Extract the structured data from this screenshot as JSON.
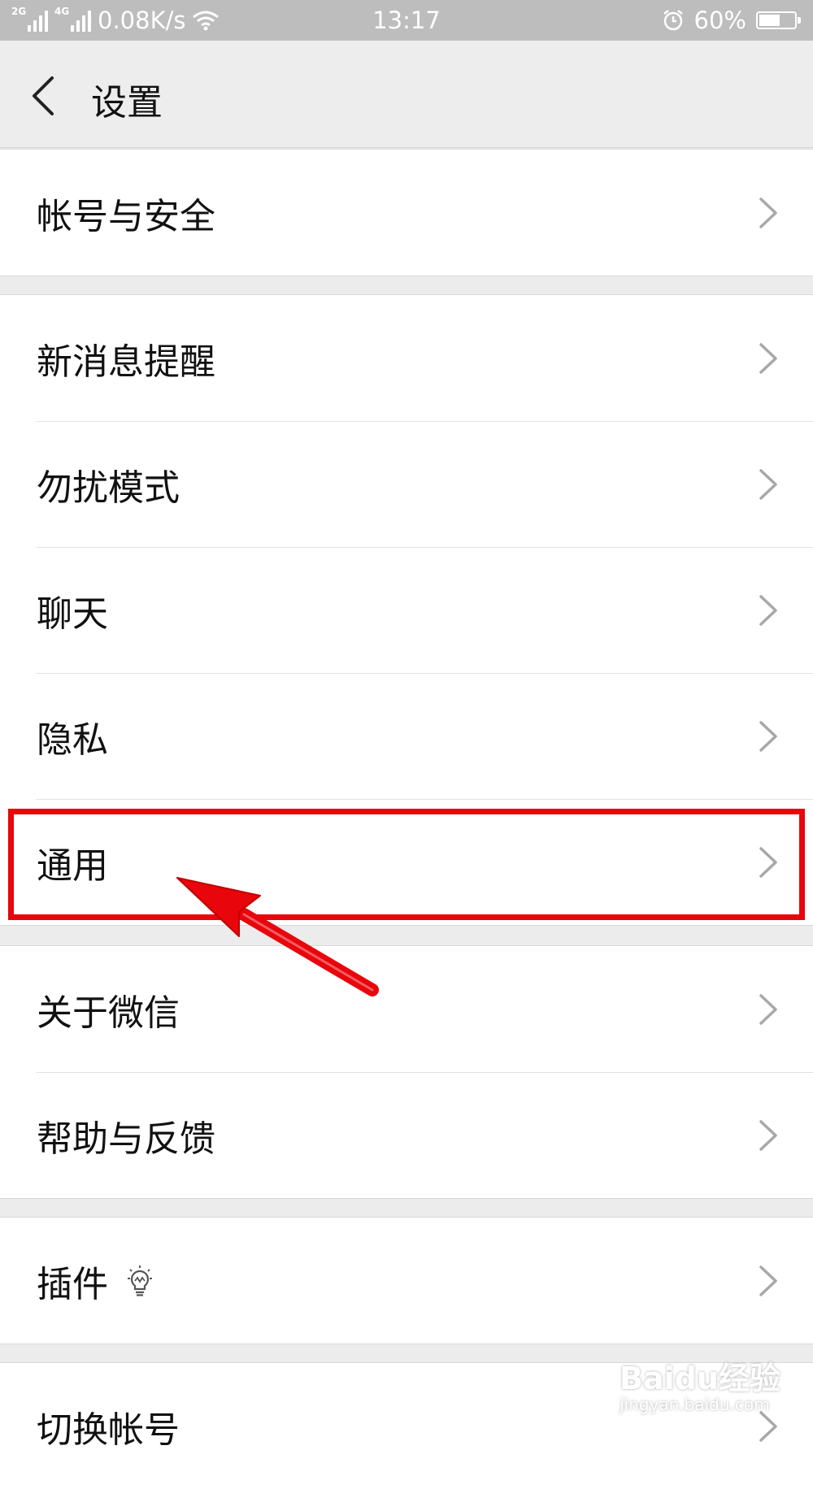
{
  "status_bar": {
    "net1": "2G",
    "net2": "4G",
    "speed": "0.08K/s",
    "time": "13:17",
    "battery_text": "60%",
    "battery_level": 0.6
  },
  "header": {
    "title": "设置"
  },
  "groups": [
    {
      "items": [
        {
          "label": "帐号与安全"
        }
      ]
    },
    {
      "items": [
        {
          "label": "新消息提醒"
        },
        {
          "label": "勿扰模式"
        },
        {
          "label": "聊天"
        },
        {
          "label": "隐私"
        },
        {
          "label": "通用"
        }
      ]
    },
    {
      "items": [
        {
          "label": "关于微信"
        },
        {
          "label": "帮助与反馈"
        }
      ]
    },
    {
      "items": [
        {
          "label": "插件"
        }
      ]
    },
    {
      "items": [
        {
          "label": "切换帐号"
        }
      ]
    }
  ],
  "watermark": {
    "brand": "Baidu经验",
    "url": "jingyan.baidu.com"
  },
  "colors": {
    "highlight": "#e8050c",
    "arrow": "#e8050c"
  }
}
